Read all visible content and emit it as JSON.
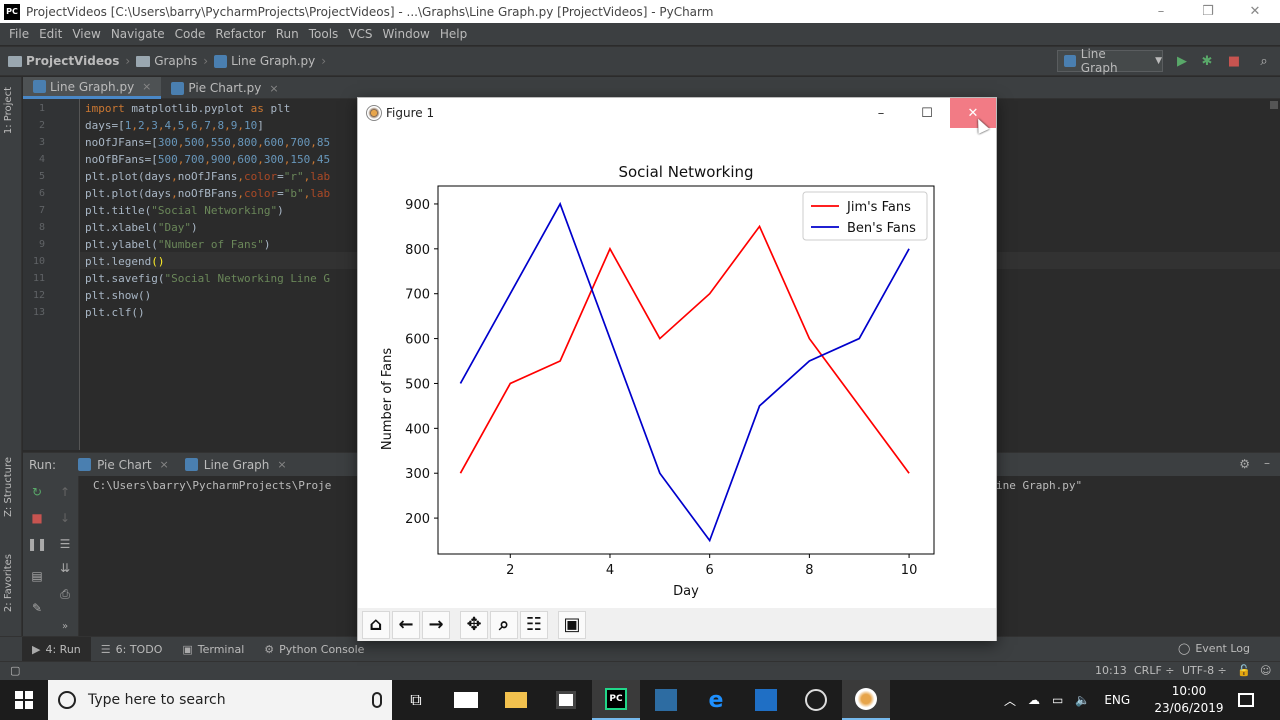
{
  "window": {
    "title": "ProjectVideos [C:\\Users\\barry\\PycharmProjects\\ProjectVideos] - ...\\Graphs\\Line Graph.py [ProjectVideos] - PyCharm",
    "app_badge": "PC",
    "controls": [
      "–",
      "❒",
      "✕"
    ]
  },
  "menu": [
    "File",
    "Edit",
    "View",
    "Navigate",
    "Code",
    "Refactor",
    "Run",
    "Tools",
    "VCS",
    "Window",
    "Help"
  ],
  "breadcrumb": [
    "ProjectVideos",
    "Graphs",
    "Line Graph.py"
  ],
  "run_config": "Line Graph",
  "editor_tabs": [
    {
      "label": "Line Graph.py",
      "close": "×"
    },
    {
      "label": "Pie Chart.py",
      "close": "×"
    }
  ],
  "side_tabs": {
    "project": "1: Project",
    "structure": "Z: Structure",
    "favorites": "2: Favorites"
  },
  "code": {
    "line_numbers": [
      "1",
      "2",
      "3",
      "4",
      "5",
      "6",
      "7",
      "8",
      "9",
      "10",
      "11",
      "12",
      "13"
    ],
    "lines": [
      [
        {
          "t": "import ",
          "c": "#cc7832"
        },
        {
          "t": "matplotlib.pyplot ",
          "c": "#a9b7c6"
        },
        {
          "t": "as ",
          "c": "#cc7832"
        },
        {
          "t": "plt",
          "c": "#a9b7c6"
        }
      ],
      [
        {
          "t": "days=[",
          "c": "#a9b7c6"
        },
        {
          "t": "1",
          "c": "#6897bb"
        },
        {
          "t": ",",
          "c": "#cc7832"
        },
        {
          "t": "2",
          "c": "#6897bb"
        },
        {
          "t": ",",
          "c": "#cc7832"
        },
        {
          "t": "3",
          "c": "#6897bb"
        },
        {
          "t": ",",
          "c": "#cc7832"
        },
        {
          "t": "4",
          "c": "#6897bb"
        },
        {
          "t": ",",
          "c": "#cc7832"
        },
        {
          "t": "5",
          "c": "#6897bb"
        },
        {
          "t": ",",
          "c": "#cc7832"
        },
        {
          "t": "6",
          "c": "#6897bb"
        },
        {
          "t": ",",
          "c": "#cc7832"
        },
        {
          "t": "7",
          "c": "#6897bb"
        },
        {
          "t": ",",
          "c": "#cc7832"
        },
        {
          "t": "8",
          "c": "#6897bb"
        },
        {
          "t": ",",
          "c": "#cc7832"
        },
        {
          "t": "9",
          "c": "#6897bb"
        },
        {
          "t": ",",
          "c": "#cc7832"
        },
        {
          "t": "10",
          "c": "#6897bb"
        },
        {
          "t": "]",
          "c": "#a9b7c6"
        }
      ],
      [
        {
          "t": "noOfJFans=[",
          "c": "#a9b7c6"
        },
        {
          "t": "300",
          "c": "#6897bb"
        },
        {
          "t": ",",
          "c": "#cc7832"
        },
        {
          "t": "500",
          "c": "#6897bb"
        },
        {
          "t": ",",
          "c": "#cc7832"
        },
        {
          "t": "550",
          "c": "#6897bb"
        },
        {
          "t": ",",
          "c": "#cc7832"
        },
        {
          "t": "800",
          "c": "#6897bb"
        },
        {
          "t": ",",
          "c": "#cc7832"
        },
        {
          "t": "600",
          "c": "#6897bb"
        },
        {
          "t": ",",
          "c": "#cc7832"
        },
        {
          "t": "700",
          "c": "#6897bb"
        },
        {
          "t": ",",
          "c": "#cc7832"
        },
        {
          "t": "85",
          "c": "#6897bb"
        }
      ],
      [
        {
          "t": "noOfBFans=[",
          "c": "#a9b7c6"
        },
        {
          "t": "500",
          "c": "#6897bb"
        },
        {
          "t": ",",
          "c": "#cc7832"
        },
        {
          "t": "700",
          "c": "#6897bb"
        },
        {
          "t": ",",
          "c": "#cc7832"
        },
        {
          "t": "900",
          "c": "#6897bb"
        },
        {
          "t": ",",
          "c": "#cc7832"
        },
        {
          "t": "600",
          "c": "#6897bb"
        },
        {
          "t": ",",
          "c": "#cc7832"
        },
        {
          "t": "300",
          "c": "#6897bb"
        },
        {
          "t": ",",
          "c": "#cc7832"
        },
        {
          "t": "150",
          "c": "#6897bb"
        },
        {
          "t": ",",
          "c": "#cc7832"
        },
        {
          "t": "45",
          "c": "#6897bb"
        }
      ],
      [
        {
          "t": "plt.plot(days",
          "c": "#a9b7c6"
        },
        {
          "t": ",",
          "c": "#cc7832"
        },
        {
          "t": "noOfJFans",
          "c": "#a9b7c6"
        },
        {
          "t": ",",
          "c": "#cc7832"
        },
        {
          "t": "color",
          "c": "#aa4926"
        },
        {
          "t": "=",
          "c": "#a9b7c6"
        },
        {
          "t": "\"r\"",
          "c": "#6a8759"
        },
        {
          "t": ",",
          "c": "#cc7832"
        },
        {
          "t": "lab",
          "c": "#aa4926"
        }
      ],
      [
        {
          "t": "plt.plot(days",
          "c": "#a9b7c6"
        },
        {
          "t": ",",
          "c": "#cc7832"
        },
        {
          "t": "noOfBFans",
          "c": "#a9b7c6"
        },
        {
          "t": ",",
          "c": "#cc7832"
        },
        {
          "t": "color",
          "c": "#aa4926"
        },
        {
          "t": "=",
          "c": "#a9b7c6"
        },
        {
          "t": "\"b\"",
          "c": "#6a8759"
        },
        {
          "t": ",",
          "c": "#cc7832"
        },
        {
          "t": "lab",
          "c": "#aa4926"
        }
      ],
      [
        {
          "t": "plt.title(",
          "c": "#a9b7c6"
        },
        {
          "t": "\"Social Networking\"",
          "c": "#6a8759"
        },
        {
          "t": ")",
          "c": "#a9b7c6"
        }
      ],
      [
        {
          "t": "plt.xlabel(",
          "c": "#a9b7c6"
        },
        {
          "t": "\"Day\"",
          "c": "#6a8759"
        },
        {
          "t": ")",
          "c": "#a9b7c6"
        }
      ],
      [
        {
          "t": "plt.ylabel(",
          "c": "#a9b7c6"
        },
        {
          "t": "\"Number of Fans\"",
          "c": "#6a8759"
        },
        {
          "t": ")",
          "c": "#a9b7c6"
        }
      ],
      [
        {
          "t": "plt.legend",
          "c": "#a9b7c6"
        },
        {
          "t": "()",
          "c": "#ffef28"
        }
      ],
      [
        {
          "t": "plt.savefig(",
          "c": "#a9b7c6"
        },
        {
          "t": "\"Social Networking Line G",
          "c": "#6a8759"
        }
      ],
      [
        {
          "t": "plt.show()",
          "c": "#a9b7c6"
        }
      ],
      [
        {
          "t": "plt.clf()",
          "c": "#a9b7c6"
        }
      ]
    ]
  },
  "run_panel": {
    "label": "Run:",
    "tabs": [
      {
        "label": "Pie Chart",
        "close": "×"
      },
      {
        "label": "Line Graph",
        "close": "×"
      }
    ],
    "console_line": "C:\\Users\\barry\\PycharmProjects\\Proje",
    "console_tail": "ine Graph.py\""
  },
  "tool_tabs": [
    {
      "label": "4: Run",
      "icon": "▶"
    },
    {
      "label": "6: TODO",
      "icon": "☰"
    },
    {
      "label": "Terminal",
      "icon": "▣"
    },
    {
      "label": "Python Console",
      "icon": "⚙"
    }
  ],
  "event_log": "Event Log",
  "status": {
    "position": "10:13",
    "line_sep": "CRLF ÷",
    "encoding": "UTF-8 ÷"
  },
  "taskbar": {
    "search_placeholder": "Type here to search",
    "lang": "ENG",
    "time": "10:00",
    "date": "23/06/2019"
  },
  "figure": {
    "window_title": "Figure 1",
    "controls": [
      "–",
      "☐",
      "✕"
    ]
  },
  "chart_data": {
    "type": "line",
    "title": "Social Networking",
    "xlabel": "Day",
    "ylabel": "Number of Fans",
    "x": [
      1,
      2,
      3,
      4,
      5,
      6,
      7,
      8,
      9,
      10
    ],
    "series": [
      {
        "name": "Jim's Fans",
        "color": "#ff0000",
        "values": [
          300,
          500,
          550,
          800,
          600,
          700,
          850,
          600,
          450,
          300
        ]
      },
      {
        "name": "Ben's Fans",
        "color": "#0000cc",
        "values": [
          500,
          700,
          900,
          600,
          300,
          150,
          450,
          550,
          600,
          800
        ]
      }
    ],
    "xticks": [
      "2",
      "4",
      "6",
      "8",
      "10"
    ],
    "yticks": [
      "200",
      "300",
      "400",
      "500",
      "600",
      "700",
      "800",
      "900"
    ],
    "xlim": [
      0.55,
      10.5
    ],
    "ylim": [
      120,
      940
    ],
    "legend": "top-right",
    "grid": false
  }
}
